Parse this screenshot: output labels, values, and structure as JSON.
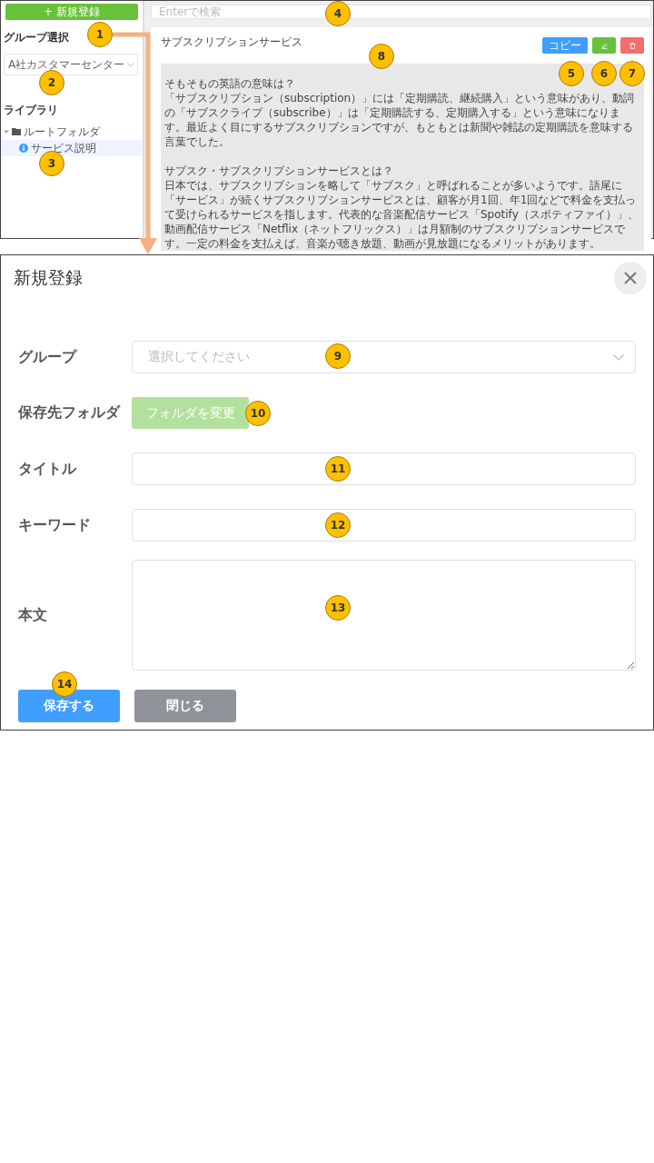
{
  "sidebar": {
    "new_button": "+ 新規登録",
    "group_label": "グループ選択",
    "group_select": "A社カスタマーセンター",
    "library_label": "ライブラリ",
    "tree": [
      {
        "label": "ルートフォルダ",
        "expanded": true,
        "selected": false,
        "children": [
          {
            "label": "サービス説明",
            "selected": true
          }
        ]
      }
    ]
  },
  "search": {
    "placeholder": "Enterで検索"
  },
  "article": {
    "title": "サブスクリプションサービス",
    "buttons": [
      {
        "kind": "copy",
        "label": "コピー"
      },
      {
        "kind": "edit"
      },
      {
        "kind": "delete"
      }
    ],
    "paragraphs": [
      {
        "heading": "そもそもの英語の意味は？",
        "text": "「サブスクリプション（subscription）」には「定期購読、継続購入」という意味があり、動詞の「サブスクライブ（subscribe）」は「定期購読する、定期購入する」という意味になります。最近よく目にするサブスクリプションですが、もともとは新聞や雑誌の定期購読を意味する言葉でした。"
      },
      {
        "heading": "サブスク・サブスクリプションサービスとは？",
        "text": "日本では、サブスクリプションを略して「サブスク」と呼ばれることが多いようです。語尾に「サービス」が続くサブスクリプションサービスとは、顧客が月1回、年1回などで料金を支払って受けられるサービスを指します。代表的な音楽配信サービス「Spotify（スポティファイ）」、動画配信サービス「Netflix（ネットフリックス）」は月額制のサブスクリプションサービスです。一定の料金を支払えば、音楽が聴き放題、動画が見放題になるメリットがあります。"
      }
    ]
  },
  "dialog": {
    "title": "新規登録",
    "fields": [
      {
        "kind": "select",
        "label": "グループ",
        "placeholder": "選択してください"
      },
      {
        "kind": "folder",
        "label": "保存先フォルダ",
        "button": "フォルダを変更"
      },
      {
        "kind": "input",
        "label": "タイトル"
      },
      {
        "kind": "input",
        "label": "キーワード"
      },
      {
        "kind": "textarea",
        "label": "本文"
      }
    ],
    "buttons": [
      {
        "kind": "primary",
        "label": "保存する"
      },
      {
        "kind": "secondary",
        "label": "閉じる"
      }
    ]
  },
  "callouts": [
    "1",
    "2",
    "3",
    "4",
    "5",
    "6",
    "7",
    "8",
    "9",
    "10",
    "11",
    "12",
    "13",
    "14"
  ]
}
